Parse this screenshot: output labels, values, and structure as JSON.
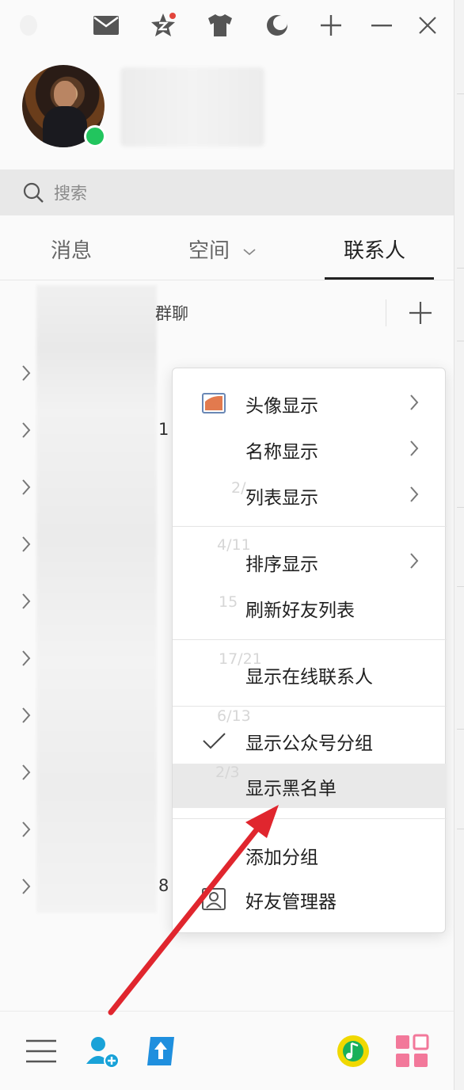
{
  "search": {
    "placeholder": "搜索"
  },
  "tabs": [
    {
      "label": "消息"
    },
    {
      "label": "空间"
    },
    {
      "label": "联系人"
    }
  ],
  "contacts": {
    "group_chat_label": "群聊",
    "row_fragments": [
      "1",
      "",
      "8"
    ]
  },
  "context_menu": {
    "items": [
      {
        "label": "头像显示",
        "has_submenu": true,
        "icon": "avatar-display-icon"
      },
      {
        "label": "名称显示",
        "has_submenu": true
      },
      {
        "label": "列表显示",
        "has_submenu": true
      },
      {
        "label": "排序显示",
        "has_submenu": true
      },
      {
        "label": "刷新好友列表"
      },
      {
        "label": "显示在线联系人"
      },
      {
        "label": "显示公众号分组",
        "checked": true
      },
      {
        "label": "显示黑名单",
        "highlighted": true
      },
      {
        "label": "添加分组"
      },
      {
        "label": "好友管理器",
        "icon": "friend-manager-icon"
      }
    ],
    "ghost_text": [
      "2/",
      "4/11",
      "15",
      "17/21",
      "6/13",
      "2/3"
    ]
  },
  "colors": {
    "online": "#22c55e",
    "annotation_arrow": "#e0262e",
    "highlight": "#e9e9e9",
    "add_contact": "#19a2d8",
    "music": "#f0d800",
    "apps": "#f2789a"
  }
}
